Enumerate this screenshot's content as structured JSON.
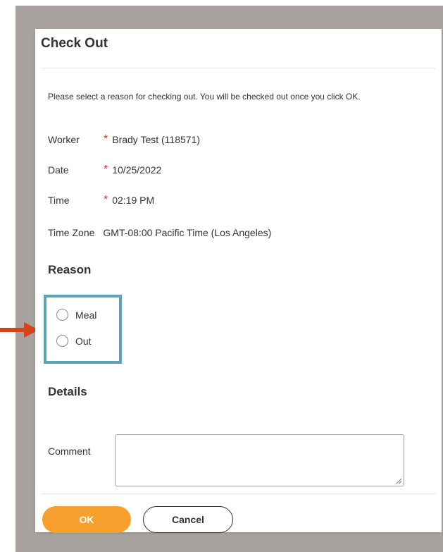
{
  "dialog": {
    "title": "Check Out",
    "instructions": "Please select a reason for checking out. You will be checked out once you click OK."
  },
  "fields": {
    "worker": {
      "label": "Worker",
      "value": "Brady Test (118571)",
      "required_mark": "*"
    },
    "date": {
      "label": "Date",
      "value": "10/25/2022",
      "required_mark": "*"
    },
    "time": {
      "label": "Time",
      "value": "02:19 PM",
      "required_mark": "*"
    },
    "time_zone": {
      "label": "Time Zone",
      "value": "GMT-08:00 Pacific Time (Los Angeles)"
    }
  },
  "reason": {
    "heading": "Reason",
    "options": [
      "Meal",
      "Out"
    ]
  },
  "details": {
    "heading": "Details",
    "comment_label": "Comment",
    "comment_value": ""
  },
  "buttons": {
    "ok": "OK",
    "cancel": "Cancel"
  },
  "colors": {
    "backdrop": "#a8a3a0",
    "ok_button": "#f7a02d",
    "required": "#d9352b",
    "highlight": "#5aa4b4",
    "arrow": "#d4451b"
  },
  "icons": {
    "annotation": "arrow-right-icon",
    "resize": "resize-grip-icon"
  }
}
